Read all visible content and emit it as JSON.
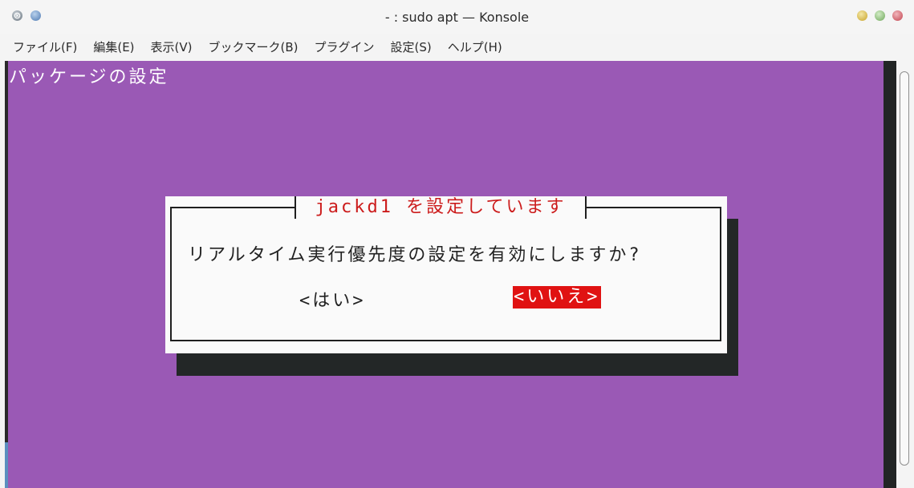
{
  "window": {
    "title": "- : sudo apt — Konsole"
  },
  "menubar": {
    "items": [
      {
        "label": "ファイル(F)"
      },
      {
        "label": "編集(E)"
      },
      {
        "label": "表示(V)"
      },
      {
        "label": "ブックマーク(B)"
      },
      {
        "label": "プラグイン"
      },
      {
        "label": "設定(S)"
      },
      {
        "label": "ヘルプ(H)"
      }
    ]
  },
  "terminal": {
    "header": "パッケージの設定",
    "background_color": "#9a59b5",
    "dialog": {
      "title": "jackd1 を設定しています",
      "question": "リアルタイム実行優先度の設定を有効にしますか?",
      "yes_label": "<はい>",
      "no_label": "<いいえ>",
      "selected": "no",
      "accent_color": "#e01212"
    }
  },
  "icons": {
    "left_buttons": [
      "window-menu-icon",
      "keep-above-icon"
    ],
    "right_buttons": [
      "minimize-icon",
      "maximize-icon",
      "close-icon"
    ]
  }
}
